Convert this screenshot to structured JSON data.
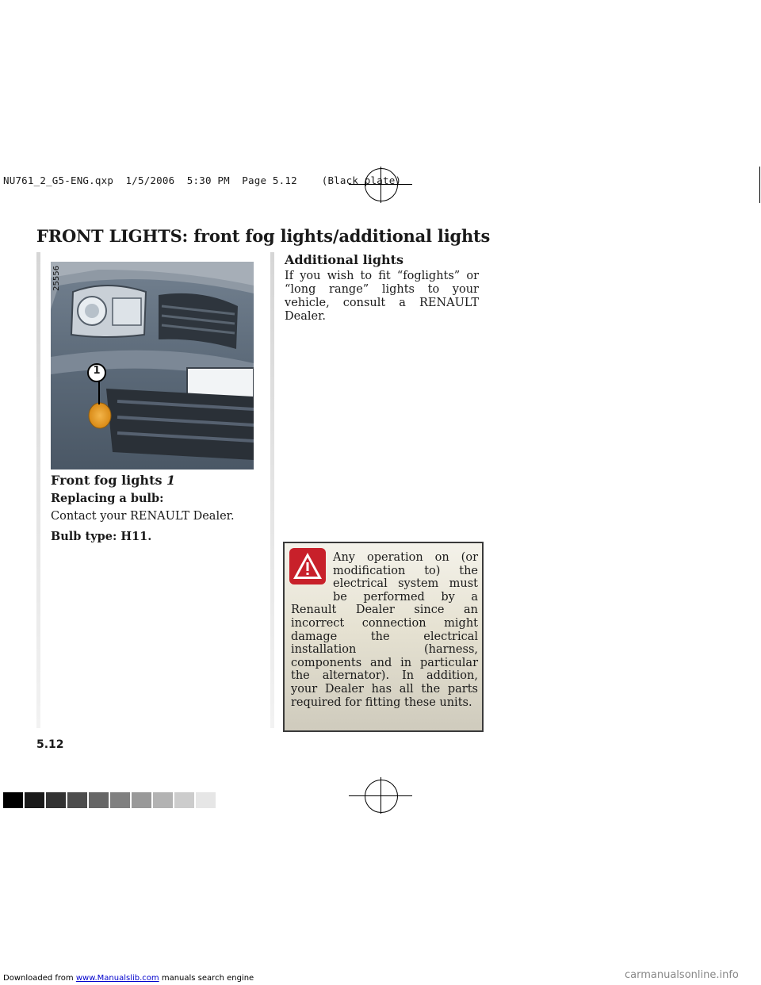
{
  "print_header": "NU761_2_G5-ENG.qxp  1/5/2006  5:30 PM  Page 5.12    (Black plate)",
  "title": "FRONT LIGHTS: front fog lights/additional lights",
  "photo": {
    "code": "25556",
    "callout": "1"
  },
  "left_column": {
    "fog_heading": "Front fog lights",
    "fog_heading_ref": "1",
    "replacing_heading": "Replacing a bulb:",
    "replacing_text": "Contact your RENAULT Dealer.",
    "bulb_type": "Bulb type: H11."
  },
  "right_column": {
    "heading": "Additional lights",
    "text": "If you wish to fit “foglights” or “long range” lights to your vehicle, consult a RENAULT Dealer."
  },
  "warning": {
    "icon": "warning-triangle-icon",
    "text": "Any operation on (or modification to) the electrical system must be performed by a Renault Dealer since an incorrect connection might damage the electrical installation (harness, components and in particular the alternator). In addition, your Dealer has all the parts required for fitting these units."
  },
  "page_number": "5.12",
  "footer": {
    "prefix": "Downloaded from",
    "link": "www.Manualslib.com",
    "suffix": "manuals search engine",
    "watermark": "carmanualsonline.info"
  },
  "colors": {
    "swatches": [
      "#000000",
      "#1a1a1a",
      "#333333",
      "#4d4d4d",
      "#666666",
      "#808080",
      "#999999",
      "#b3b3b3",
      "#cccccc",
      "#e6e6e6"
    ],
    "warning_red": "#c8202a"
  }
}
